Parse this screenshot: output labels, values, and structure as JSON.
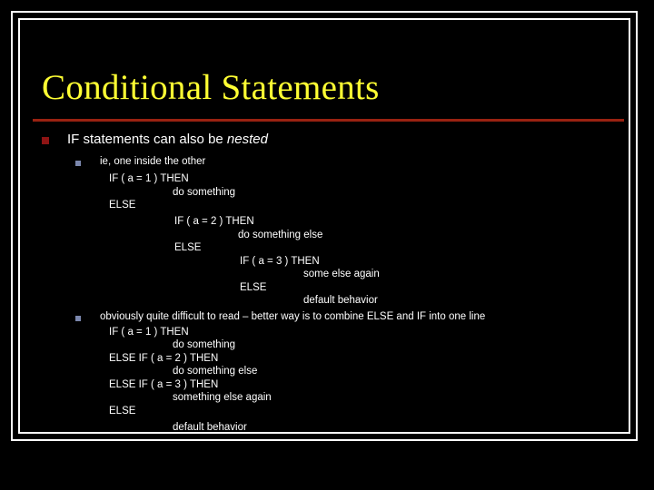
{
  "slide": {
    "title": "Conditional Statements",
    "accent_rule_color": "#992211",
    "title_color": "#ffff33",
    "background_color": "#000000",
    "bullet_l1_color": "#8e1414",
    "bullet_l2_color": "#7b87ad",
    "text_color": "#ffffff"
  },
  "content": {
    "bullet1": {
      "text_plain": "IF statements can also be nested",
      "text_before": "IF statements can also be ",
      "text_italic": "nested"
    },
    "sub1": {
      "label": "ie, one inside the other",
      "code": [
        {
          "text": "IF ( a = 1 ) THEN",
          "indent": 120
        },
        {
          "text": "do something",
          "indent": 190
        },
        {
          "text": "ELSE",
          "indent": 120
        },
        {
          "text": "IF ( a = 2 ) THEN",
          "indent": 192
        },
        {
          "text": "do something else",
          "indent": 262
        },
        {
          "text": "ELSE",
          "indent": 192
        },
        {
          "text": "IF ( a = 3 ) THEN",
          "indent": 264
        },
        {
          "text": "some else again",
          "indent": 334
        },
        {
          "text": "ELSE",
          "indent": 264
        },
        {
          "text": "default behavior",
          "indent": 334
        }
      ]
    },
    "sub2": {
      "label": "obviously quite difficult to read – better way is to combine ELSE and IF into one line",
      "code": [
        {
          "text": "IF ( a = 1 ) THEN",
          "indent": 120
        },
        {
          "text": "do something",
          "indent": 190
        },
        {
          "text": "ELSE IF ( a = 2 ) THEN",
          "indent": 120
        },
        {
          "text": "do something else",
          "indent": 190
        },
        {
          "text": "ELSE IF ( a = 3 ) THEN",
          "indent": 120
        },
        {
          "text": "something else again",
          "indent": 190
        },
        {
          "text": "ELSE",
          "indent": 120
        },
        {
          "text": "default behavior",
          "indent": 190
        }
      ]
    }
  }
}
